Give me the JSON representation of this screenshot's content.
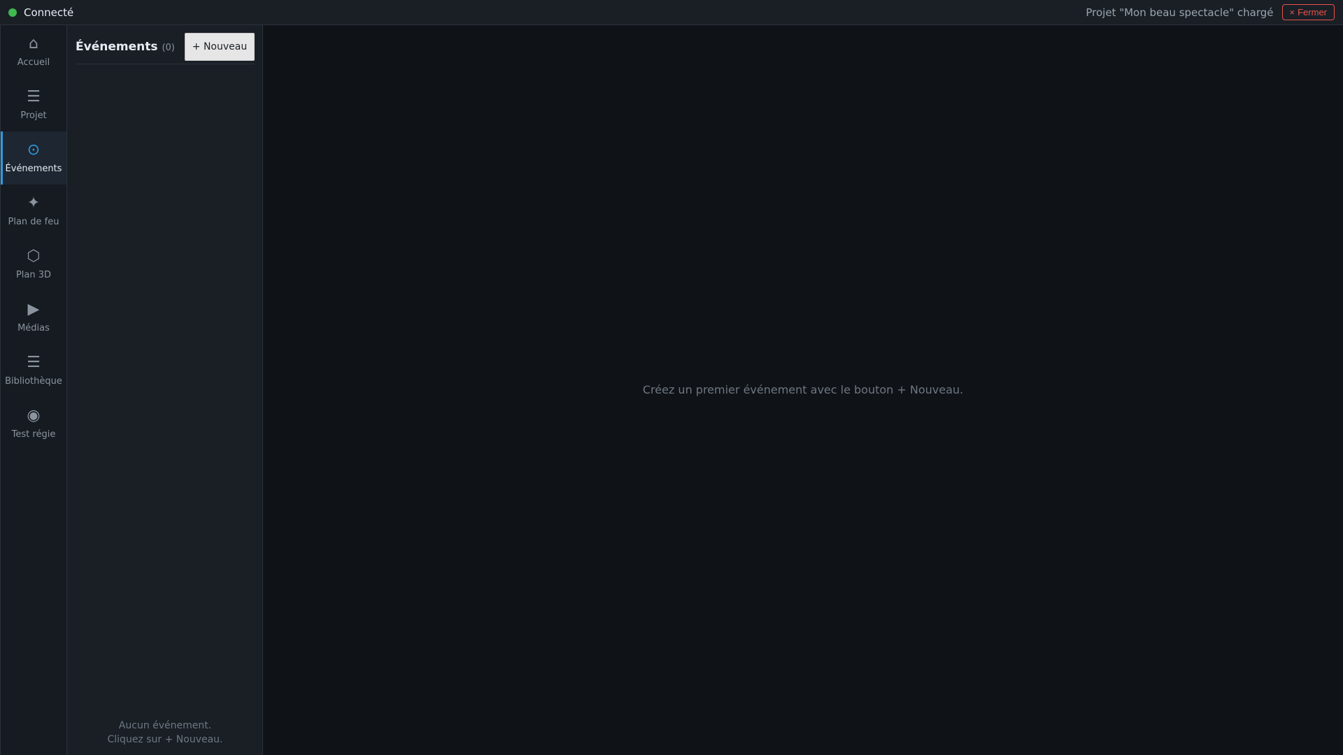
{
  "topbar": {
    "connection_status": "Connecté",
    "connection_color": "#3fb950",
    "project_status": "Projet \"Mon beau spectacle\" chargé",
    "close_label": "Fermer",
    "close_icon": "×"
  },
  "sidebar": {
    "items": [
      {
        "icon": "home-icon",
        "glyph": "⌂",
        "label": "Accueil",
        "active": false
      },
      {
        "icon": "menu-icon",
        "glyph": "☰",
        "label": "Projet",
        "active": false
      },
      {
        "icon": "target-icon",
        "glyph": "⊙",
        "label": "Événements",
        "active": true
      },
      {
        "icon": "sparkle-icon",
        "glyph": "✦",
        "label": "Plan de feu",
        "active": false
      },
      {
        "icon": "hexagon-icon",
        "glyph": "⬡",
        "label": "Plan 3D",
        "active": false
      },
      {
        "icon": "play-icon",
        "glyph": "▶",
        "label": "Médias",
        "active": false
      },
      {
        "icon": "list-icon",
        "glyph": "☰",
        "label": "Bibliothèque",
        "active": false
      },
      {
        "icon": "record-icon",
        "glyph": "◉",
        "label": "Test régie",
        "active": false
      }
    ]
  },
  "events_panel": {
    "title": "Événements",
    "count": "(0)",
    "new_button_label": "+ Nouveau",
    "empty_line1": "Aucun événement.",
    "empty_line2": "Cliquez sur + Nouveau."
  },
  "main": {
    "empty_message": "Créez un premier événement avec le bouton + Nouveau."
  },
  "colors": {
    "accent": "#2f9ae0",
    "danger": "#e5534b",
    "background": "#0f1217"
  }
}
